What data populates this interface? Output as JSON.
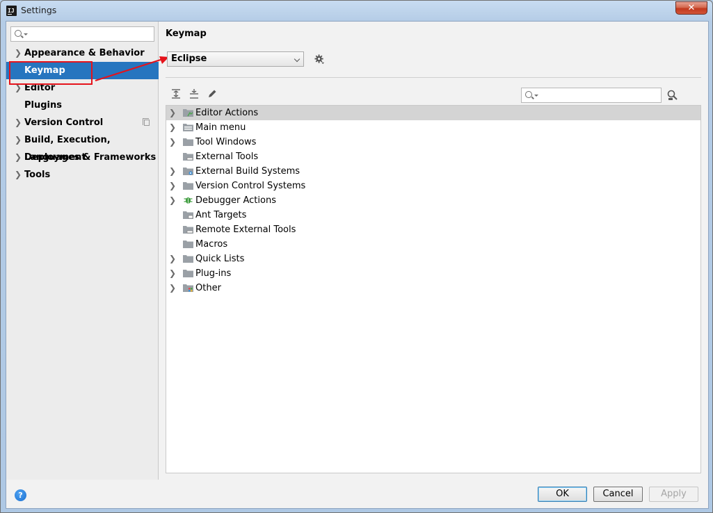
{
  "window": {
    "title": "Settings",
    "close_label": "✕"
  },
  "sidebar": {
    "search": {
      "placeholder": ""
    },
    "items": [
      {
        "label": "Appearance & Behavior",
        "expandable": true
      },
      {
        "label": "Keymap",
        "expandable": false,
        "selected": true
      },
      {
        "label": "Editor",
        "expandable": true
      },
      {
        "label": "Plugins",
        "expandable": false
      },
      {
        "label": "Version Control",
        "expandable": true
      },
      {
        "label": "Build, Execution, Deployment",
        "expandable": true
      },
      {
        "label": "Languages & Frameworks",
        "expandable": true
      },
      {
        "label": "Tools",
        "expandable": true
      }
    ]
  },
  "main": {
    "title": "Keymap",
    "keymap_select": {
      "value": "Eclipse"
    },
    "tree_search": {
      "placeholder": ""
    },
    "tree": [
      {
        "label": "Editor Actions",
        "expandable": true,
        "selected": true,
        "icon": "editor-actions-folder-icon"
      },
      {
        "label": "Main menu",
        "expandable": true,
        "icon": "menu-folder-icon"
      },
      {
        "label": "Tool Windows",
        "expandable": true,
        "icon": "folder-icon"
      },
      {
        "label": "External Tools",
        "expandable": false,
        "icon": "external-tools-folder-icon"
      },
      {
        "label": "External Build Systems",
        "expandable": true,
        "icon": "build-systems-folder-icon"
      },
      {
        "label": "Version Control Systems",
        "expandable": true,
        "icon": "folder-icon"
      },
      {
        "label": "Debugger Actions",
        "expandable": true,
        "icon": "bug-icon"
      },
      {
        "label": "Ant Targets",
        "expandable": false,
        "icon": "ant-folder-icon"
      },
      {
        "label": "Remote External Tools",
        "expandable": false,
        "icon": "external-tools-folder-icon"
      },
      {
        "label": "Macros",
        "expandable": false,
        "icon": "folder-icon"
      },
      {
        "label": "Quick Lists",
        "expandable": true,
        "icon": "folder-icon"
      },
      {
        "label": "Plug-ins",
        "expandable": true,
        "icon": "folder-icon"
      },
      {
        "label": "Other",
        "expandable": true,
        "icon": "other-folder-icon"
      }
    ]
  },
  "footer": {
    "help_label": "?",
    "ok_label": "OK",
    "cancel_label": "Cancel",
    "apply_label": "Apply"
  },
  "colors": {
    "selection": "#2675bf",
    "annotation_red": "#e5131b"
  }
}
